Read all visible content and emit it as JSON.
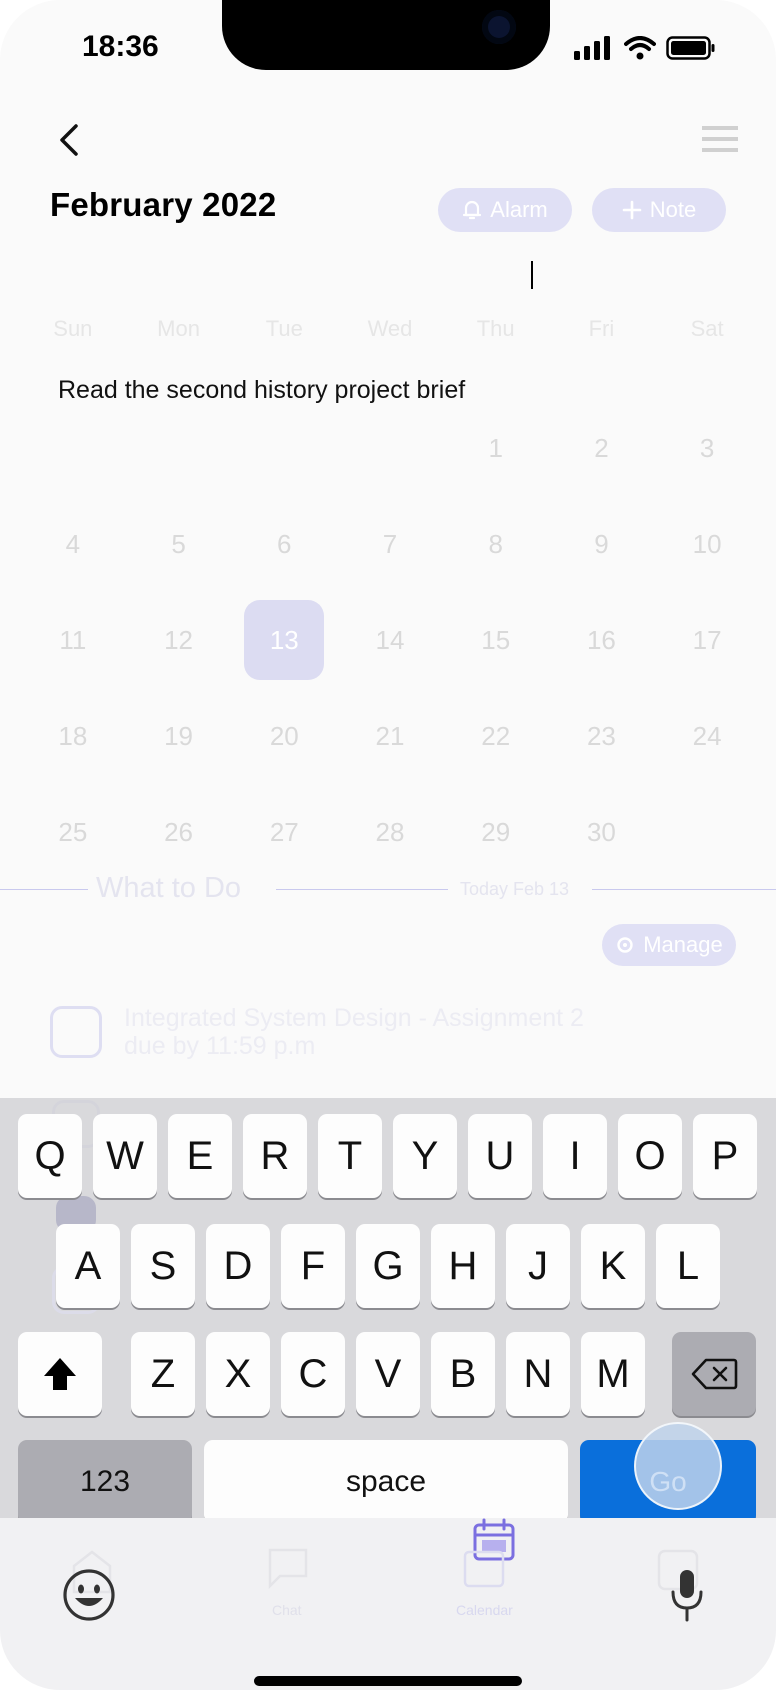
{
  "status_bar": {
    "time": "18:36"
  },
  "header": {
    "month_title": "February 2022",
    "alarm_label": "Alarm",
    "note_label": "Note"
  },
  "calendar": {
    "weekdays": [
      "Sun",
      "Mon",
      "Tue",
      "Wed",
      "Thu",
      "Fri",
      "Sat"
    ],
    "weeks": [
      [
        "",
        "",
        "",
        "",
        "1",
        "2",
        "3"
      ],
      [
        "4",
        "5",
        "6",
        "7",
        "8",
        "9",
        "10"
      ],
      [
        "11",
        "12",
        "13",
        "14",
        "15",
        "16",
        "17"
      ],
      [
        "18",
        "19",
        "20",
        "21",
        "22",
        "23",
        "24"
      ],
      [
        "25",
        "26",
        "27",
        "28",
        "29",
        "30",
        ""
      ]
    ],
    "selected_day": "13"
  },
  "note_input": {
    "value": "Read the second history project brief"
  },
  "todo": {
    "title": "What to Do",
    "today_label": "Today Feb 13",
    "manage_label": "Manage",
    "tasks": [
      {
        "line1": "Integrated System Design - Assignment 2",
        "line2": "due by 11:59 p.m"
      }
    ]
  },
  "keyboard": {
    "row1": [
      "Q",
      "W",
      "E",
      "R",
      "T",
      "Y",
      "U",
      "I",
      "O",
      "P"
    ],
    "row2": [
      "A",
      "S",
      "D",
      "F",
      "G",
      "H",
      "J",
      "K",
      "L"
    ],
    "row3": [
      "Z",
      "X",
      "C",
      "V",
      "B",
      "N",
      "M"
    ],
    "numbers_label": "123",
    "space_label": "space",
    "go_label": "Go"
  },
  "tabbar": {
    "chat_label": "Chat",
    "calendar_label": "Calendar"
  },
  "colors": {
    "accent": "#7b6fe0",
    "go_key": "#0a6fdb",
    "keyboard_bg": "#d2d2d6"
  }
}
